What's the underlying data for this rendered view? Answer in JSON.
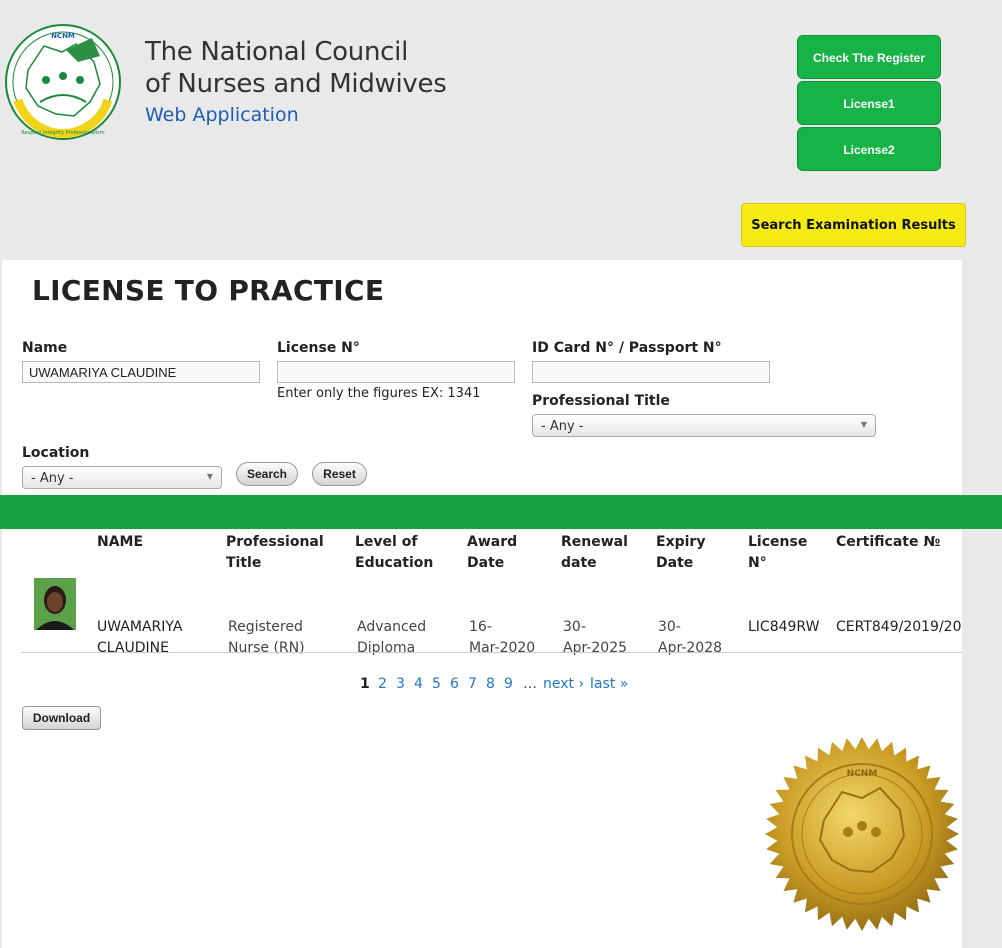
{
  "header": {
    "logo_text": "NCNM",
    "logo_motto": "Respect Integrity Professionalism",
    "title_line1": "The National Council",
    "title_line2": "of Nurses and Midwives",
    "subtitle": "Web Application",
    "buttons": {
      "check_register": "Check The Register",
      "license1": "License1",
      "license2": "License2",
      "exam_results": "Search Examination Results"
    }
  },
  "page": {
    "title": "LICENSE TO PRACTICE"
  },
  "filters": {
    "name": {
      "label": "Name",
      "value": "UWAMARIYA CLAUDINE"
    },
    "license_no": {
      "label": "License N°",
      "value": "",
      "help": "Enter only the figures EX: 1341"
    },
    "id_card": {
      "label": "ID Card N° / Passport N°",
      "value": ""
    },
    "professional_title": {
      "label": "Professional Title",
      "selected": "- Any -"
    },
    "location": {
      "label": "Location",
      "selected": "- Any -"
    },
    "search_label": "Search",
    "reset_label": "Reset"
  },
  "table": {
    "headers": {
      "name": "NAME",
      "title_1": "Professional",
      "title_2": "Title",
      "level_1": "Level of",
      "level_2": "Education",
      "award_1": "Award",
      "award_2": "Date",
      "renewal_1": "Renewal",
      "renewal_2": "date",
      "expiry_1": "Expiry",
      "expiry_2": "Date",
      "license_1": "License",
      "license_2": "N°",
      "certificate": "Certificate №"
    },
    "row": {
      "name_1": "UWAMARIYA",
      "name_2": "CLAUDINE",
      "title_1": "Registered",
      "title_2": "Nurse (RN)",
      "level_1": "Advanced",
      "level_2": "Diploma",
      "award_1": "16-",
      "award_2": "Mar-2020",
      "renewal_1": "30-",
      "renewal_2": "Apr-2025",
      "expiry_1": "30-",
      "expiry_2": "Apr-2028",
      "license": "LIC849RW",
      "certificate": "CERT849/2019/20"
    }
  },
  "pager": {
    "current": "1",
    "pages": [
      "2",
      "3",
      "4",
      "5",
      "6",
      "7",
      "8",
      "9"
    ],
    "ellipsis": "…",
    "next": "next ›",
    "last": "last »"
  },
  "download_label": "Download",
  "seal_text": "NCNM",
  "colors": {
    "green": "#17b346",
    "band_green": "#17a33f",
    "yellow": "#f5ea14",
    "link_blue": "#1f77c9",
    "title_blue": "#1f5db6"
  }
}
